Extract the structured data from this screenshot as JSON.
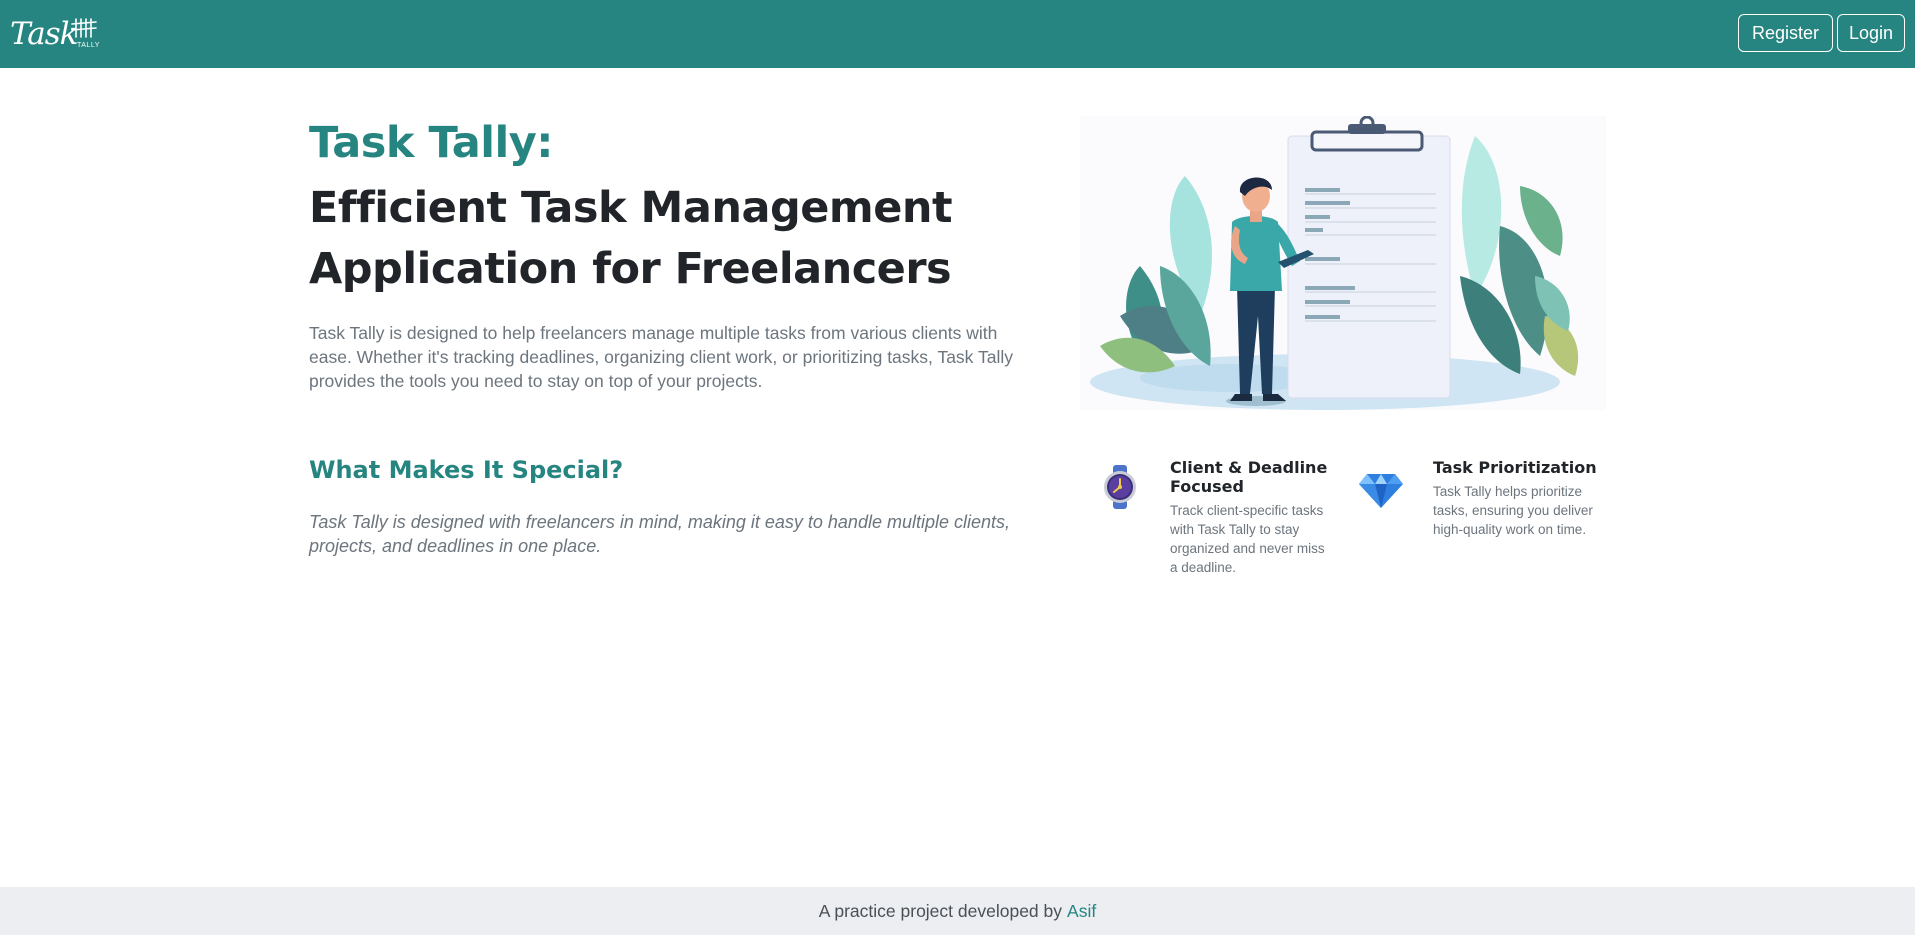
{
  "brand": {
    "logo_script": "Task",
    "logo_sub": "TALLY",
    "accent_color": "#268580"
  },
  "nav": {
    "register_label": "Register",
    "login_label": "Login"
  },
  "hero": {
    "title_accent": "Task Tally:",
    "title_main": "Efficient Task Management Application for Freelancers",
    "description": "Task Tally is designed to help freelancers manage multiple tasks from various clients with ease. Whether it's tracking deadlines, organizing client work, or prioritizing tasks, Task Tally provides the tools you need to stay on top of your projects."
  },
  "special": {
    "title": "What Makes It Special?",
    "description": "Task Tally is designed with freelancers in mind, making it easy to handle multiple clients, projects, and deadlines in one place."
  },
  "features": [
    {
      "icon": "watch-icon",
      "title": "Client & Deadline Focused",
      "text": "Track client-specific tasks with Task Tally to stay organized and never miss a deadline."
    },
    {
      "icon": "diamond-icon",
      "title": "Task Prioritization",
      "text": "Task Tally helps prioritize tasks, ensuring you deliver high-quality work on time."
    }
  ],
  "footer": {
    "text": "A practice project developed by",
    "author": "Asif"
  }
}
